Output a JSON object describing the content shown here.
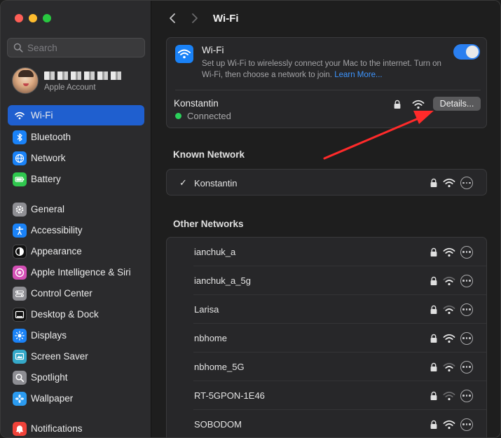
{
  "window": {
    "traffic_lights": [
      "close",
      "minimize",
      "maximize"
    ]
  },
  "sidebar": {
    "search_placeholder": "Search",
    "account": {
      "subtitle": "Apple Account"
    },
    "items": [
      {
        "label": "Wi-Fi",
        "icon": "wifi-icon",
        "color": "#1a82f7",
        "active": true
      },
      {
        "label": "Bluetooth",
        "icon": "bluetooth-icon",
        "color": "#1a82f7"
      },
      {
        "label": "Network",
        "icon": "globe-icon",
        "color": "#1a82f7"
      },
      {
        "label": "Battery",
        "icon": "battery-icon",
        "color": "#2fc84e"
      },
      {
        "label": "General",
        "icon": "gear-icon",
        "color": "#8e8e93"
      },
      {
        "label": "Accessibility",
        "icon": "accessibility-icon",
        "color": "#1a82f7"
      },
      {
        "label": "Appearance",
        "icon": "appearance-icon",
        "color": "#111111"
      },
      {
        "label": "Apple Intelligence & Siri",
        "icon": "siri-icon",
        "color": "#d44fb5"
      },
      {
        "label": "Control Center",
        "icon": "control-center-icon",
        "color": "#8e8e93"
      },
      {
        "label": "Desktop & Dock",
        "icon": "dock-icon",
        "color": "#111111"
      },
      {
        "label": "Displays",
        "icon": "sun-icon",
        "color": "#1a82f7"
      },
      {
        "label": "Screen Saver",
        "icon": "screen-saver-icon",
        "color": "#35a9c9"
      },
      {
        "label": "Spotlight",
        "icon": "magnifier-icon",
        "color": "#8e8e93"
      },
      {
        "label": "Wallpaper",
        "icon": "flower-icon",
        "color": "#2b9bf0"
      },
      {
        "label": "Notifications",
        "icon": "bell-icon",
        "color": "#f0433a"
      }
    ]
  },
  "main": {
    "title": "Wi-Fi",
    "wifi_card": {
      "title": "Wi-Fi",
      "description": "Set up Wi-Fi to wirelessly connect your Mac to the internet. Turn on Wi-Fi, then choose a network to join.",
      "link": "Learn More...",
      "toggle_on": true,
      "connected_network": "Konstantin",
      "status": "Connected",
      "details_button": "Details..."
    },
    "known_section_title": "Known Network",
    "known_networks": [
      {
        "name": "Konstantin",
        "checked": true,
        "signal": 3
      }
    ],
    "other_section_title": "Other Networks",
    "other_networks": [
      {
        "name": "ianchuk_a",
        "signal": 3
      },
      {
        "name": "ianchuk_a_5g",
        "signal": 2
      },
      {
        "name": "Larisa",
        "signal": 2
      },
      {
        "name": "nbhome",
        "signal": 3
      },
      {
        "name": "nbhome_5G",
        "signal": 2
      },
      {
        "name": "RT-5GPON-1E46",
        "signal": 1
      },
      {
        "name": "SOBODOM",
        "signal": 3
      }
    ]
  },
  "colors": {
    "accent": "#1f5fcf",
    "annotation_arrow": "#ff2a2a",
    "connected": "#2bd05b"
  }
}
